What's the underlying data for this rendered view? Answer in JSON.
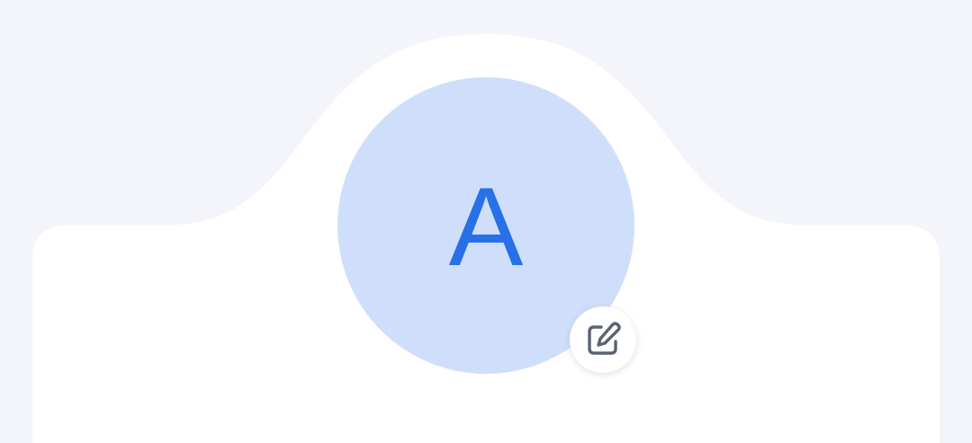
{
  "profile": {
    "avatar_initial": "A",
    "avatar_background": "#cfdffb",
    "accent_color": "#2870e8",
    "edit_icon": "edit-pencil-square-icon"
  },
  "colors": {
    "page_background": "#f3f5fa",
    "card_background": "#ffffff",
    "icon_color": "#5b6271"
  }
}
